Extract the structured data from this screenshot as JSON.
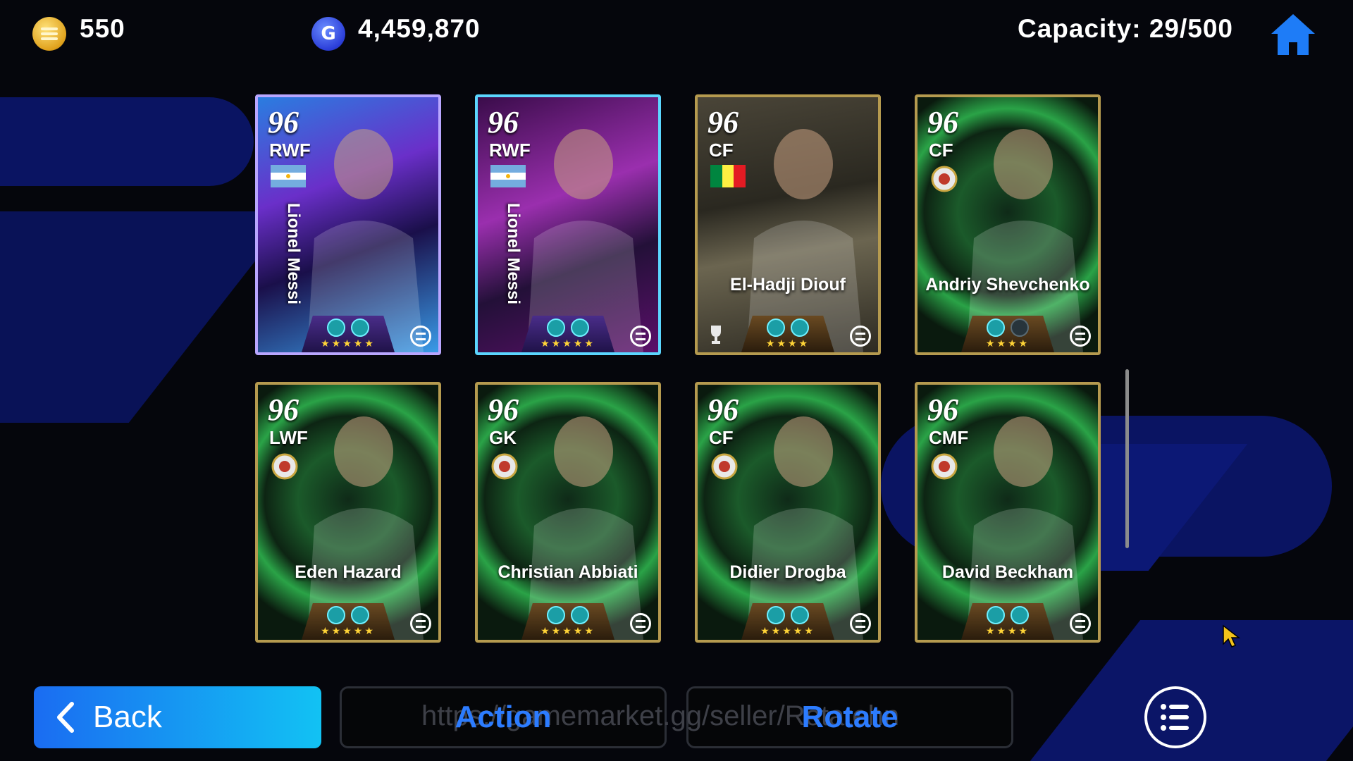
{
  "currency": {
    "coins_icon": "gold-coin-icon",
    "coins": "550",
    "gp_icon": "gp-coin-icon",
    "gp_letter": "G",
    "gp": "4,459,870"
  },
  "capacity": "Capacity: 29/500",
  "cards": [
    {
      "rating": "96",
      "position": "RWF",
      "name": "Lionel Messi",
      "style": "purple",
      "stars": "★★★★★",
      "skills": 2
    },
    {
      "rating": "96",
      "position": "RWF",
      "name": "Lionel Messi",
      "style": "purple-alt",
      "stars": "★★★★★",
      "skills": 2
    },
    {
      "rating": "96",
      "position": "CF",
      "name": "El-Hadji Diouf",
      "style": "gold-legend",
      "stars": "★★★★",
      "skills": 2
    },
    {
      "rating": "96",
      "position": "CF",
      "name": "Andriy Shevchenko",
      "style": "green",
      "stars": "★★★★",
      "skills": 1
    },
    {
      "rating": "96",
      "position": "LWF",
      "name": "Eden Hazard",
      "style": "green",
      "stars": "★★★★★",
      "skills": 2
    },
    {
      "rating": "96",
      "position": "GK",
      "name": "Christian Abbiati",
      "style": "green",
      "stars": "★★★★★",
      "skills": 2
    },
    {
      "rating": "96",
      "position": "CF",
      "name": "Didier Drogba",
      "style": "green",
      "stars": "★★★★★",
      "skills": 2
    },
    {
      "rating": "96",
      "position": "CMF",
      "name": "David Beckham",
      "style": "green",
      "stars": "★★★★",
      "skills": 2
    }
  ],
  "buttons": {
    "back": "Back",
    "action": "Action",
    "rotate": "Rotate"
  },
  "watermark": "https://gamemarket.gg/seller/Rotatehn",
  "colors": {
    "accent": "#2c7cff",
    "back_gradient_start": "#1a6cf2",
    "back_gradient_end": "#12c2f3",
    "card_gold_border": "#b59a4f"
  }
}
